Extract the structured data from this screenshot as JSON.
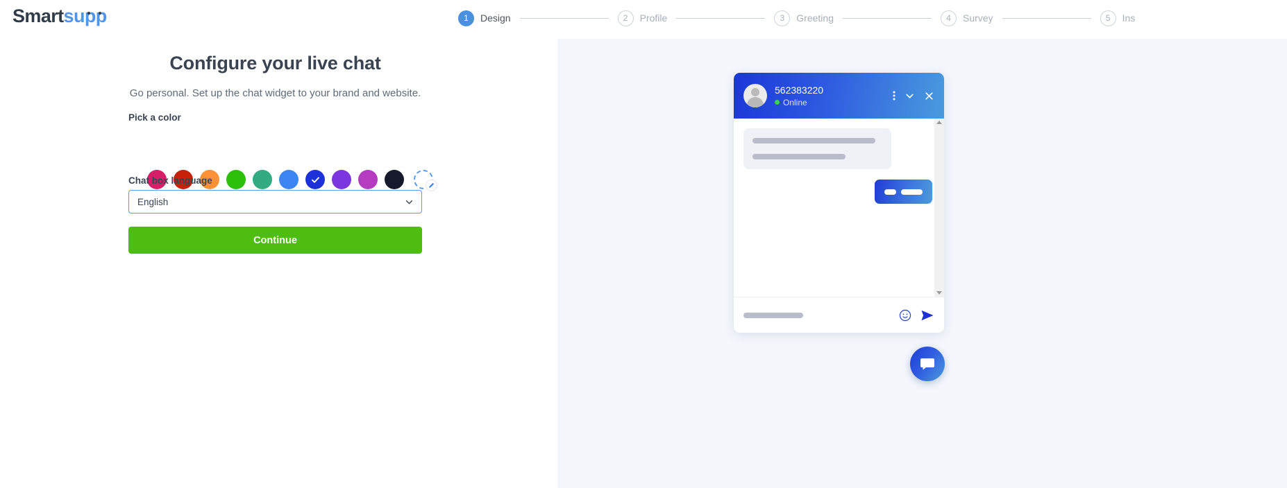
{
  "brand": {
    "logo_part1": "Smart",
    "logo_part2": "supp"
  },
  "stepper": {
    "steps": [
      {
        "number": "1",
        "label": "Design",
        "active": true
      },
      {
        "number": "2",
        "label": "Profile",
        "active": false
      },
      {
        "number": "3",
        "label": "Greeting",
        "active": false
      },
      {
        "number": "4",
        "label": "Survey",
        "active": false
      },
      {
        "number": "5",
        "label": "Ins",
        "active": false
      }
    ]
  },
  "form": {
    "title": "Configure your live chat",
    "subtitle": "Go personal. Set up the chat widget to your brand and website.",
    "color_label": "Pick a color",
    "swatches": [
      {
        "name": "pink",
        "hex": "#d61f69",
        "selected": false
      },
      {
        "name": "dark-red",
        "hex": "#c62209",
        "selected": false
      },
      {
        "name": "orange",
        "hex": "#fc9238",
        "selected": false
      },
      {
        "name": "green",
        "hex": "#2dc00b",
        "selected": false
      },
      {
        "name": "teal",
        "hex": "#33ab82",
        "selected": false
      },
      {
        "name": "light-blue",
        "hex": "#3b86f4",
        "selected": false
      },
      {
        "name": "blue",
        "hex": "#1c31d8",
        "selected": true
      },
      {
        "name": "violet",
        "hex": "#7b36e0",
        "selected": false
      },
      {
        "name": "magenta",
        "hex": "#b43cc0",
        "selected": false
      },
      {
        "name": "black",
        "hex": "#171a2b",
        "selected": false
      }
    ],
    "custom_color": {
      "name": "custom-color-picker",
      "border_hex": "#5a9bf0",
      "pencil_hex": "#3b82f6"
    },
    "language_label": "Chat box language",
    "language_value": "English",
    "language_options": [
      "English"
    ],
    "continue_label": "Continue",
    "continue_hex": "#4fbd0f"
  },
  "preview": {
    "chat": {
      "title": "562383220",
      "status": "Online",
      "status_dot_hex": "#3fd14a",
      "header_gradient_from": "#1a37d8",
      "header_gradient_to": "#4a9bdd"
    },
    "launcher_label": "chat-launcher"
  }
}
